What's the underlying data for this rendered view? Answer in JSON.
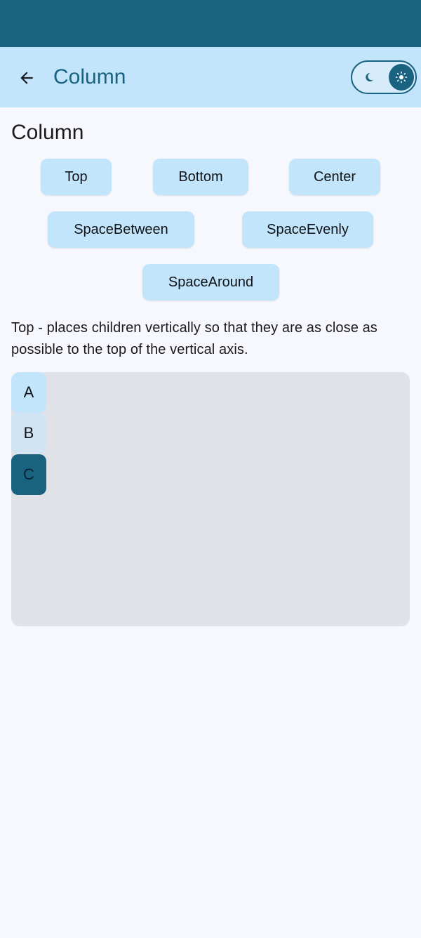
{
  "app_bar": {
    "title": "Column",
    "back_icon": "arrow-left-icon",
    "theme_toggle": {
      "left_icon": "moon-icon",
      "right_icon": "sun-icon",
      "selected": "light"
    }
  },
  "section": {
    "title": "Column"
  },
  "arrangement_buttons": [
    {
      "label": "Top"
    },
    {
      "label": "Bottom"
    },
    {
      "label": "Center"
    },
    {
      "label": "SpaceBetween"
    },
    {
      "label": "SpaceEvenly"
    },
    {
      "label": "SpaceAround"
    }
  ],
  "description": "Top - places children vertically so that they are as close as possible to the top of the vertical axis.",
  "demo": {
    "items": [
      {
        "label": "A",
        "color": "#c2e5fb",
        "text_color": "#101418"
      },
      {
        "label": "B",
        "color": "#d0e4f3",
        "text_color": "#101418"
      },
      {
        "label": "C",
        "color": "#1a6380",
        "text_color": "#0b2230"
      }
    ]
  },
  "colors": {
    "primary": "#1a6380",
    "primary_container": "#c2e5fb",
    "background": "#f7f8fd",
    "surface_variant": "#e1e2e7"
  }
}
